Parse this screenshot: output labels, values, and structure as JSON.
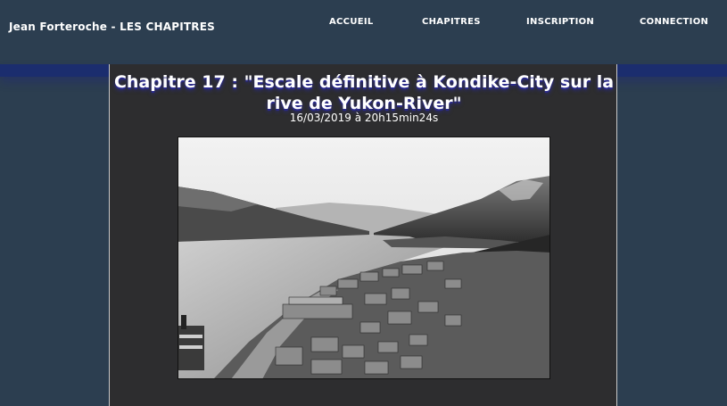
{
  "navbar": {
    "brand": "Jean Forteroche - LES CHAPITRES",
    "links": [
      "ACCUEIL",
      "CHAPITRES",
      "INSCRIPTION",
      "CONNECTION"
    ]
  },
  "chapter": {
    "title": "Chapitre 17 : \"Escale définitive à Kondike-City sur la rive de Yukon-River\"",
    "date": "16/03/2019 à 20h15min24s",
    "image": "black-and-white photograph of a river town in a valley"
  },
  "colors": {
    "background": "#2c3e50",
    "content_panel": "#2d2d2f",
    "nav_underline": "#1b2d6e",
    "text": "#ffffff"
  }
}
